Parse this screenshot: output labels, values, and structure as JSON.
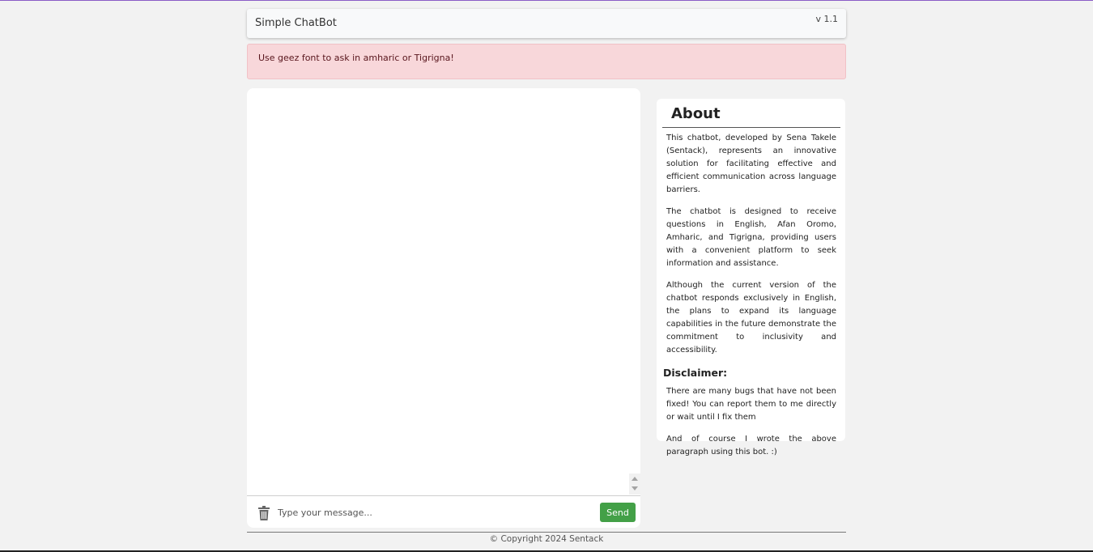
{
  "navbar": {
    "brand": "Simple ChatBot",
    "version": "v 1.1"
  },
  "alert": {
    "text": "Use geez font to ask in amharic or Tigrigna!"
  },
  "chat": {
    "input_placeholder": "Type your message...",
    "send_label": "Send",
    "clear_icon": "trash-icon"
  },
  "about": {
    "title": "About",
    "paragraphs": [
      "This chatbot, developed by Sena Takele (Sentack), represents an innovative solution for facilitating effective and efficient communication across language barriers.",
      "The chatbot is designed to receive questions in English, Afan Oromo, Amharic, and Tigrigna, providing users with a convenient platform to seek information and assistance.",
      "Although the current version of the chatbot responds exclusively in English, the plans to expand its language capabilities in the future demonstrate the commitment to inclusivity and accessibility."
    ],
    "disclaimer_title": "Disclaimer:",
    "disclaimer_paragraphs": [
      "There are many bugs that have not been fixed! You can report them to me directly or wait until I fix them",
      "And of course I wrote the above paragraph using this bot. :)"
    ]
  },
  "footer": {
    "text": "© Copyright 2024 Sentack"
  },
  "colors": {
    "send": "#43a047",
    "alert_bg": "#f8d7da",
    "alert_text": "#58151c",
    "page_bg": "#f2f2f2"
  }
}
